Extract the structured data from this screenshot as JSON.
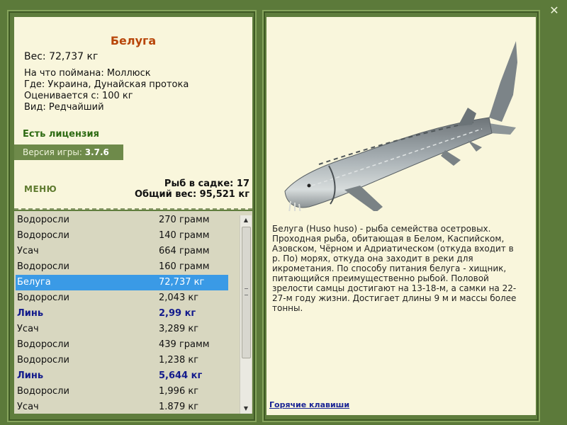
{
  "fish": {
    "name": "Белуга",
    "weight_text": "Вес: 72,737 кг",
    "details": [
      "На что поймана: Моллюск",
      "Где: Украина, Дунайская протока",
      "Оценивается с: 100 кг",
      "Вид: Редчайший"
    ],
    "license": "Есть лицензия",
    "description": "Белуга (Huso huso) - рыба семейства осетровых. Проходная рыба, обитающая в Белом, Каспийском, Азовском, Чёрном и Адриатическом (откуда входит в р. По) морях, откуда она заходит в реки для икрометания. По способу питания белуга - хищник, питающийся преимущественно рыбой. Половой зрелости самцы достигают на 13-18-м, а самки на 22-27-м году жизни. Достигает длины 9 м и массы более тонны."
  },
  "version": {
    "label": "Версия игры:",
    "value": "3.7.6"
  },
  "menu_label": "МЕНЮ",
  "cage": {
    "count_text": "Рыб в садке: 17",
    "total_text": "Общий вес: 95,521 кг"
  },
  "catch_list": [
    {
      "name": "Водоросли",
      "weight": "270 грамм",
      "style": "normal"
    },
    {
      "name": "Водоросли",
      "weight": "140 грамм",
      "style": "normal"
    },
    {
      "name": "Усач",
      "weight": "664 грамм",
      "style": "normal"
    },
    {
      "name": "Водоросли",
      "weight": "160 грамм",
      "style": "normal"
    },
    {
      "name": "Белуга",
      "weight": "72,737 кг",
      "style": "selected"
    },
    {
      "name": "Водоросли",
      "weight": "2,043 кг",
      "style": "normal"
    },
    {
      "name": "Линь",
      "weight": "2,99 кг",
      "style": "bold"
    },
    {
      "name": "Усач",
      "weight": "3,289 кг",
      "style": "normal"
    },
    {
      "name": "Водоросли",
      "weight": "439 грамм",
      "style": "normal"
    },
    {
      "name": "Водоросли",
      "weight": "1,238 кг",
      "style": "normal"
    },
    {
      "name": "Линь",
      "weight": "5,644 кг",
      "style": "bold"
    },
    {
      "name": "Водоросли",
      "weight": "1,996 кг",
      "style": "normal"
    },
    {
      "name": "Усач",
      "weight": "1.879 кг",
      "style": "normal"
    }
  ],
  "hotkeys_label": "Горячие клавиши",
  "icons": {
    "close": "close-icon",
    "fish_image": "beluga-sturgeon-image"
  },
  "colors": {
    "frame": "#5f7d3d",
    "panel": "#f9f6dc",
    "list_bg": "#d8d7c0",
    "selected_row": "#3a9ae6",
    "title": "#b8460a",
    "license": "#2d6a12",
    "bold_row": "#131b8c"
  }
}
